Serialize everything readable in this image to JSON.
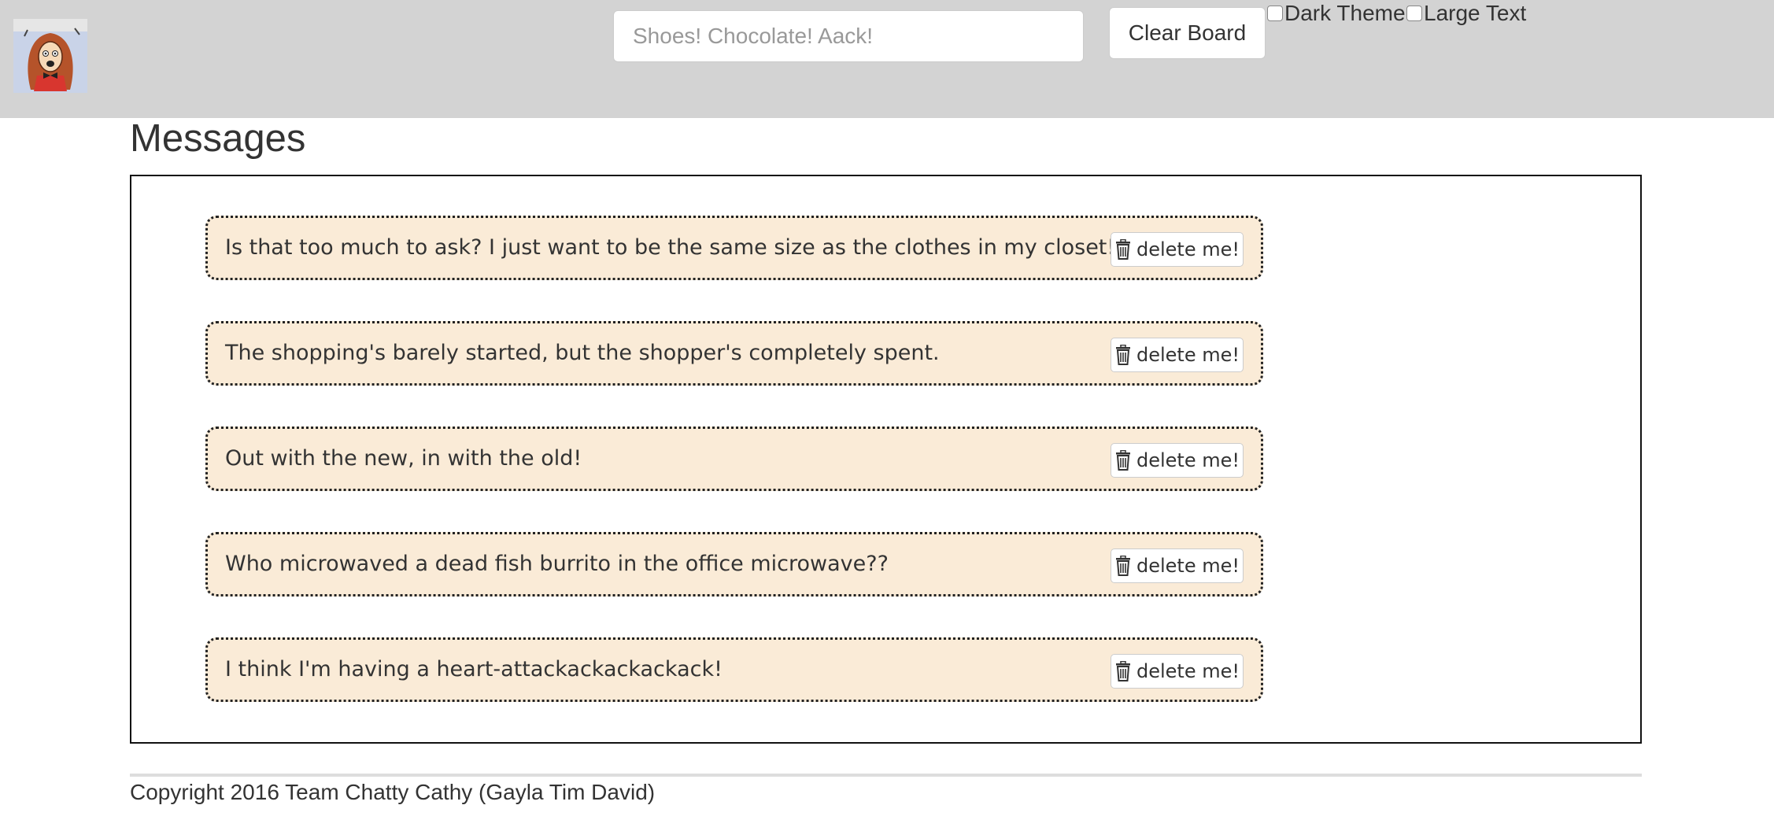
{
  "header": {
    "logo_icon": "cartoon-woman-icon",
    "search": {
      "placeholder": "Shoes! Chocolate! Aack!",
      "value": ""
    },
    "clear_button_label": "Clear Board",
    "toggles": [
      {
        "label": "Dark Theme",
        "checked": false
      },
      {
        "label": "Large Text",
        "checked": false
      }
    ]
  },
  "main": {
    "title": "Messages",
    "messages": [
      {
        "text": "Is that too much to ask? I just want to be the same size as the clothes in my closet!",
        "delete_label": "delete me!",
        "delete_icon": "trash-icon"
      },
      {
        "text": "The shopping's barely started, but the shopper's completely spent.",
        "delete_label": "delete me!",
        "delete_icon": "trash-icon"
      },
      {
        "text": "Out with the new, in with the old!",
        "delete_label": "delete me!",
        "delete_icon": "trash-icon"
      },
      {
        "text": "Who microwaved a dead fish burrito in the office microwave??",
        "delete_label": "delete me!",
        "delete_icon": "trash-icon"
      },
      {
        "text": "I think I'm having a heart-attackackackackack!",
        "delete_label": "delete me!",
        "delete_icon": "trash-icon"
      }
    ]
  },
  "footer": {
    "copyright": "Copyright 2016 Team Chatty Cathy (Gayla Tim David)"
  },
  "colors": {
    "header_bg": "#d3d3d3",
    "message_bg": "#faebd7",
    "text": "#333333"
  }
}
